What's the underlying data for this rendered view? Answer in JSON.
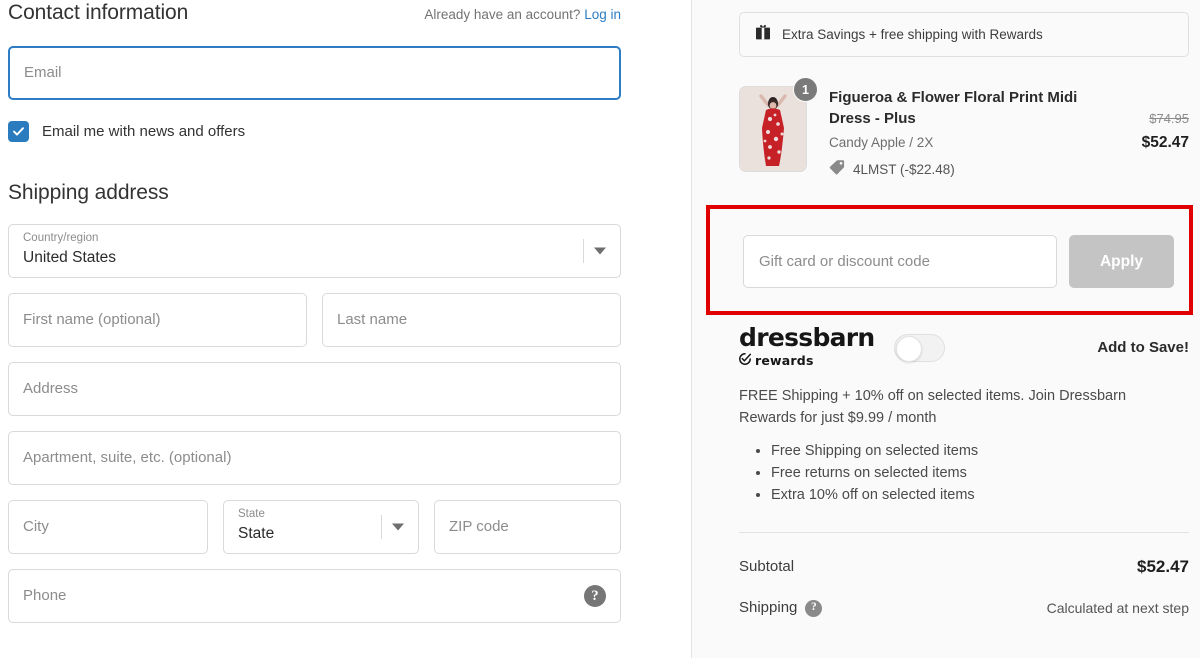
{
  "contact": {
    "title": "Contact information",
    "login_prompt": "Already have an account?",
    "login_link": "Log in",
    "email_placeholder": "Email",
    "newsletter_label": "Email me with news and offers"
  },
  "shipping": {
    "title": "Shipping address",
    "country_label": "Country/region",
    "country_value": "United States",
    "first_name_placeholder": "First name (optional)",
    "last_name_placeholder": "Last name",
    "address_placeholder": "Address",
    "apartment_placeholder": "Apartment, suite, etc. (optional)",
    "city_placeholder": "City",
    "state_label": "State",
    "state_value": "State",
    "zip_placeholder": "ZIP code",
    "phone_placeholder": "Phone",
    "phone_help": "?"
  },
  "summary": {
    "rewards_banner": "Extra Savings + free shipping with Rewards",
    "item": {
      "quantity": "1",
      "title": "Figueroa & Flower Floral Print Midi Dress - Plus",
      "variant": "Candy Apple / 2X",
      "discount_code": "4LMST (-$22.48)",
      "price_original": "$74.95",
      "price_final": "$52.47"
    },
    "discount": {
      "placeholder": "Gift card or discount code",
      "apply_label": "Apply"
    },
    "rewards": {
      "logo_main": "dressbarn",
      "logo_sub": "rewards",
      "add_to_save": "Add to Save!",
      "description": "FREE Shipping + 10% off on selected items. Join Dressbarn Rewards for just $9.99 / month",
      "benefits": [
        "Free Shipping on selected items",
        "Free returns on selected items",
        "Extra 10% off on selected items"
      ]
    },
    "totals": [
      {
        "label": "Subtotal",
        "value": "$52.47",
        "muted": false,
        "has_help": false
      },
      {
        "label": "Shipping",
        "value": "Calculated at next step",
        "muted": true,
        "has_help": true
      }
    ],
    "shipping_help": "?"
  },
  "colors": {
    "accent_blue": "#2e7cc3",
    "checkbox_blue": "#2b7cbf",
    "highlight_red": "#e00000",
    "apply_gray": "#c4c4c4",
    "panel_bg": "#fafafa"
  }
}
